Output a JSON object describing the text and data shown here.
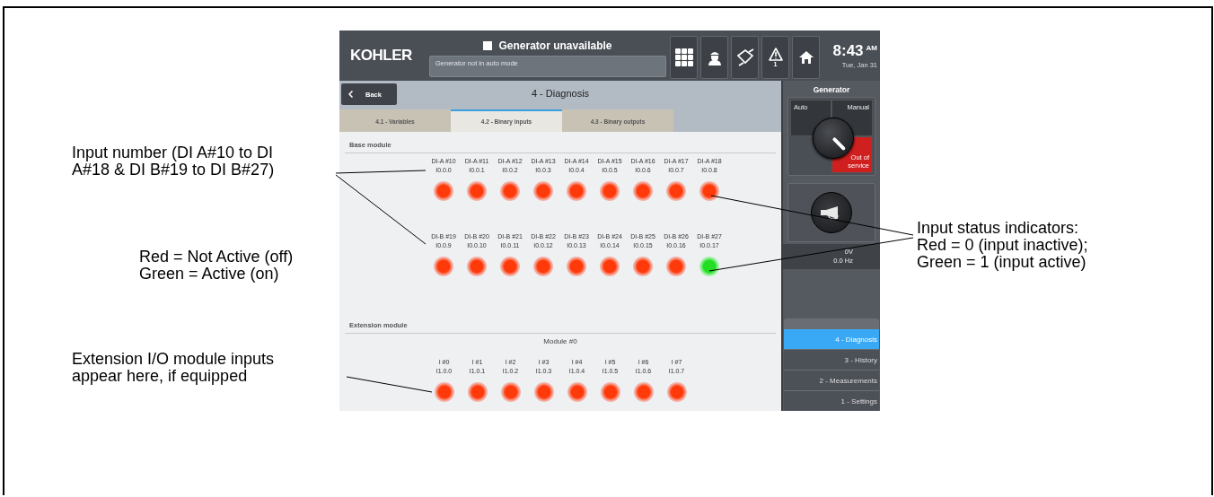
{
  "callouts": [
    {
      "text": "Input number (DI A#10 to DI\nA#18 & DI B#19 to DI B#27)"
    },
    {
      "text": "Red = Not Active (off)\nGreen = Active (on)"
    },
    {
      "text": "Extension I/O module inputs\nappear here, if equipped"
    }
  ],
  "status_callout": {
    "text": "Input status indicators:\nRed = 0 (input inactive);\nGreen = 1 (input active)"
  },
  "screen": {
    "logo": "KOHLER",
    "status": {
      "title": "Generator unavailable",
      "message": "Generator not in auto mode"
    },
    "alarm_count": "1",
    "clock": {
      "time": "8:43",
      "ampm": "AM",
      "date": "Tue, Jan 31"
    },
    "back": "Back",
    "page_title": "4 - Diagnosis",
    "tabs": [
      {
        "label": "4.1 - Variables",
        "selected": false
      },
      {
        "label": "4.2 - Binary inputs",
        "selected": true
      },
      {
        "label": "4.3 - Binary outputs",
        "selected": false
      }
    ],
    "sections": [
      {
        "title": "Base module",
        "groups": [
          {
            "inputs": [
              {
                "name": "DI-A #10",
                "address": "I0.0.0",
                "active": false
              },
              {
                "name": "DI-A #11",
                "address": "I0.0.1",
                "active": false
              },
              {
                "name": "DI-A #12",
                "address": "I0.0.2",
                "active": false
              },
              {
                "name": "DI-A #13",
                "address": "I0.0.3",
                "active": false
              },
              {
                "name": "DI-A #14",
                "address": "I0.0.4",
                "active": false
              },
              {
                "name": "DI-A #15",
                "address": "I0.0.5",
                "active": false
              },
              {
                "name": "DI-A #16",
                "address": "I0.0.6",
                "active": false
              },
              {
                "name": "DI-A #17",
                "address": "I0.0.7",
                "active": false
              },
              {
                "name": "DI-A #18",
                "address": "I0.0.8",
                "active": false
              }
            ]
          },
          {
            "inputs": [
              {
                "name": "DI-B #19",
                "address": "I0.0.9",
                "active": false
              },
              {
                "name": "DI-B #20",
                "address": "I0.0.10",
                "active": false
              },
              {
                "name": "DI-B #21",
                "address": "I0.0.11",
                "active": false
              },
              {
                "name": "DI-B #22",
                "address": "I0.0.12",
                "active": false
              },
              {
                "name": "DI-B #23",
                "address": "I0.0.13",
                "active": false
              },
              {
                "name": "DI-B #24",
                "address": "I0.0.14",
                "active": false
              },
              {
                "name": "DI-B #25",
                "address": "I0.0.15",
                "active": false
              },
              {
                "name": "DI-B #26",
                "address": "I0.0.16",
                "active": false
              },
              {
                "name": "DI-B #27",
                "address": "I0.0.17",
                "active": true
              }
            ]
          }
        ]
      },
      {
        "title": "Extension module",
        "groups": [
          {
            "title": "Module #0",
            "inputs": [
              {
                "name": "I #0",
                "address": "I1.0.0",
                "active": false
              },
              {
                "name": "I #1",
                "address": "I1.0.1",
                "active": false
              },
              {
                "name": "I #2",
                "address": "I1.0.2",
                "active": false
              },
              {
                "name": "I #3",
                "address": "I1.0.3",
                "active": false
              },
              {
                "name": "I #4",
                "address": "I1.0.4",
                "active": false
              },
              {
                "name": "I #5",
                "address": "I1.0.5",
                "active": false
              },
              {
                "name": "I #6",
                "address": "I1.0.6",
                "active": false
              },
              {
                "name": "I #7",
                "address": "I1.0.7",
                "active": false
              }
            ]
          }
        ]
      }
    ],
    "generator": {
      "title": "Generator",
      "modes": [
        {
          "label": "Auto",
          "selected": false
        },
        {
          "label": "Manual",
          "selected": false
        },
        {
          "label": "Out of service",
          "selected": true
        }
      ],
      "voltage": "0V",
      "frequency": "0.0 Hz"
    },
    "menu": [
      {
        "label": "4 - Diagnosis",
        "selected": true
      },
      {
        "label": "3 - History",
        "selected": false
      },
      {
        "label": "2 - Measurements",
        "selected": false
      },
      {
        "label": "1 - Settings",
        "selected": false
      }
    ]
  }
}
